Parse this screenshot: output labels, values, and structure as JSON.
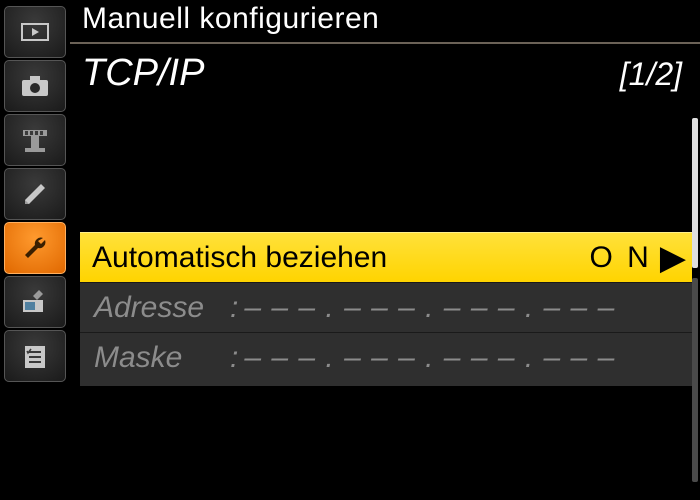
{
  "title": "Manuell konfigurieren",
  "subtitle": "TCP/IP",
  "pager": "[1/2]",
  "row_auto": {
    "label": "Automatisch beziehen",
    "value": "O N",
    "arrow": "▶"
  },
  "row_addr": {
    "label": "Adresse",
    "colon": ":",
    "value": "– – – .  – – – .  – – – .  – – –"
  },
  "row_mask": {
    "label": "Maske",
    "colon": ":",
    "value": "– – – .  – – – .  – – – .  – – –"
  },
  "sidebar": {
    "items": [
      {
        "name": "playback",
        "active": false
      },
      {
        "name": "camera",
        "active": false
      },
      {
        "name": "video",
        "active": false
      },
      {
        "name": "edit",
        "active": false
      },
      {
        "name": "setup",
        "active": true
      },
      {
        "name": "retouch",
        "active": false
      },
      {
        "name": "mymenu",
        "active": false
      }
    ]
  }
}
